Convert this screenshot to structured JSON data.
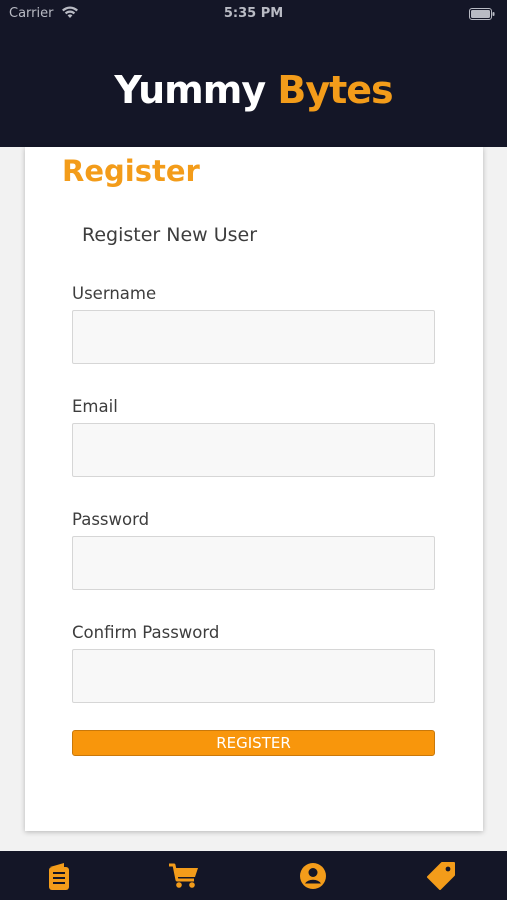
{
  "status_bar": {
    "carrier": "Carrier",
    "time": "5:35 PM"
  },
  "header": {
    "logo_part1": "Yummy",
    "logo_part2": "Bytes"
  },
  "form": {
    "title": "Register",
    "subtitle": "Register New User",
    "fields": [
      {
        "label": "Username",
        "value": ""
      },
      {
        "label": "Email",
        "value": ""
      },
      {
        "label": "Password",
        "value": ""
      },
      {
        "label": "Confirm Password",
        "value": ""
      }
    ],
    "submit_label": "REGISTER"
  },
  "tabbar": {
    "icons": [
      "menu-icon",
      "cart-icon",
      "account-icon",
      "tag-icon"
    ],
    "color": "#f39c1a"
  },
  "colors": {
    "accent": "#f39c1a",
    "header_bg": "#141627",
    "button_bg": "#f8960c"
  }
}
